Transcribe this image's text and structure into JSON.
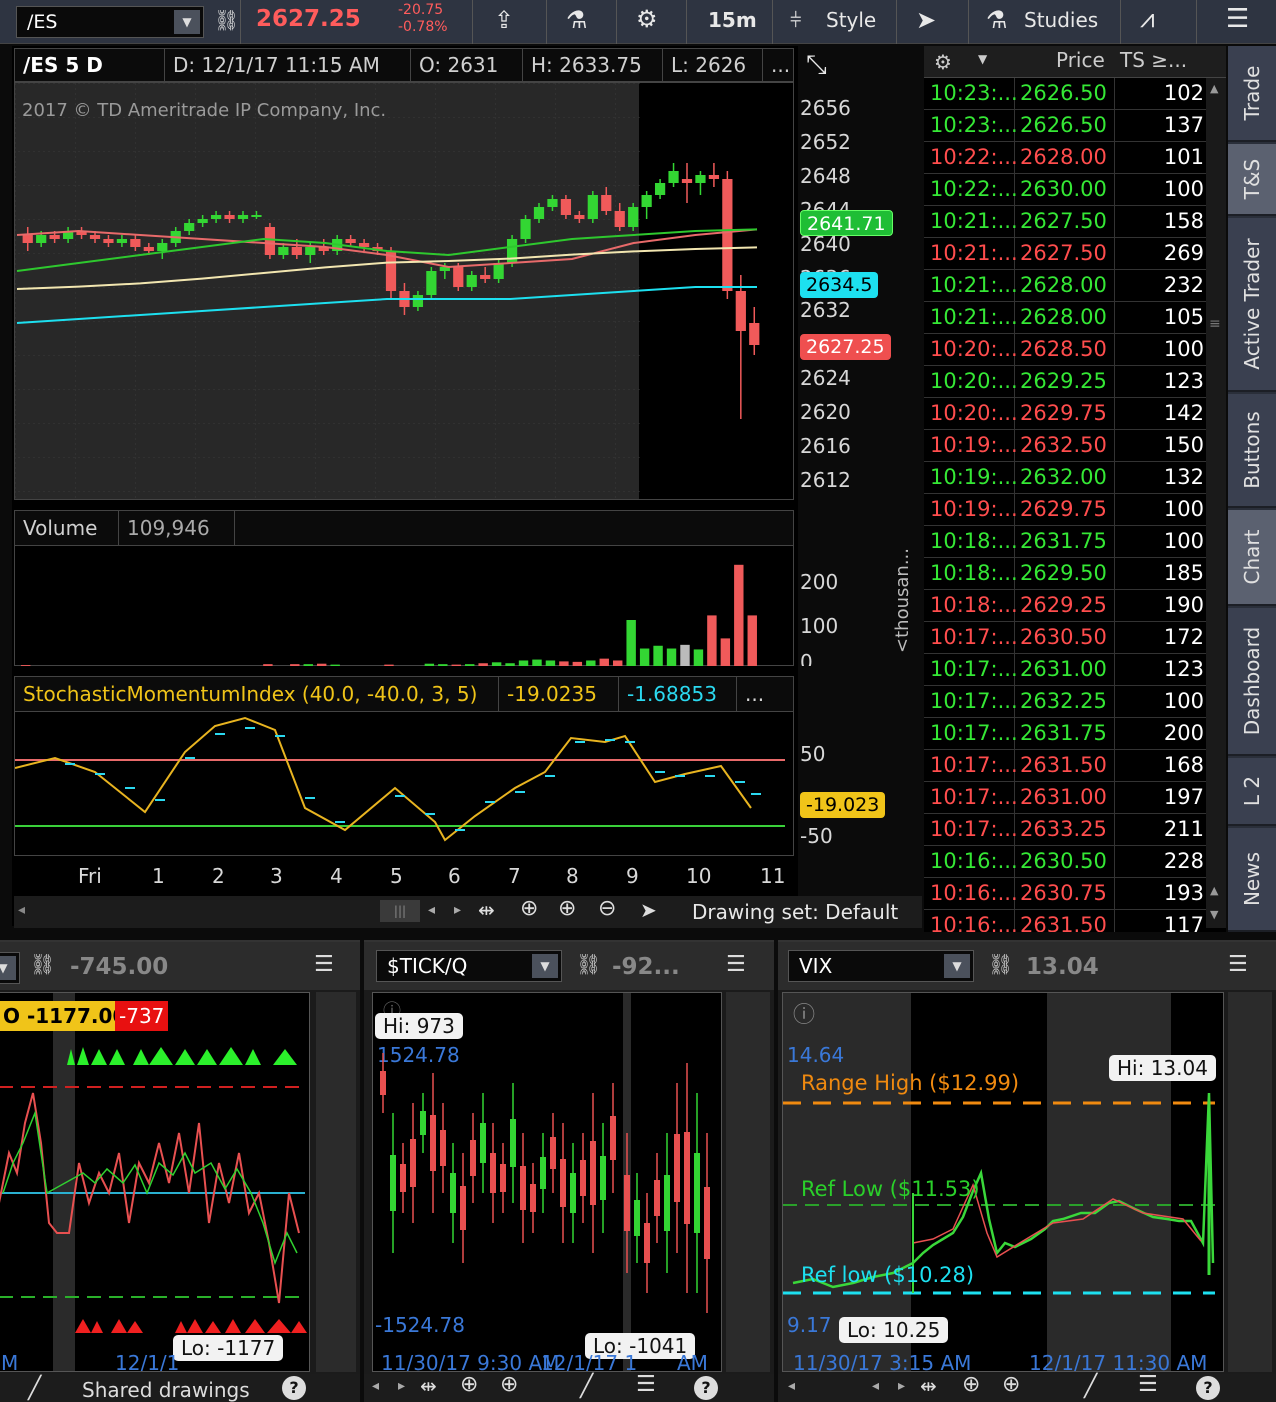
{
  "toolbar": {
    "symbol": "/ES",
    "last": "2627.25",
    "net_change": "-20.75",
    "net_change_pct": "-0.78%",
    "timeframe": "15m",
    "style_label": "Style",
    "studies_label": "Studies"
  },
  "chart": {
    "header": {
      "title": "/ES 5 D 15m",
      "date": "D: 12/1/17 11:15 AM",
      "open": "O: 2631",
      "high": "H: 2633.75",
      "low": "L: 2626",
      "more": "..."
    },
    "copyright": "2017 © TD Ameritrade IP Company, Inc.",
    "y_ticks": [
      "2656",
      "2652",
      "2648",
      "2644",
      "2640",
      "2636",
      "2632",
      "2624",
      "2620",
      "2616",
      "2612"
    ],
    "tags": {
      "green": "2641.71",
      "cyan": "2634.5",
      "red": "2627.25"
    },
    "volume": {
      "label": "Volume",
      "value": "109,946",
      "ticks": [
        "200",
        "100",
        "0"
      ],
      "unit": "<thousan..."
    },
    "smi": {
      "label": "StochasticMomentumIndex (40.0, -40.0, 3, 5)",
      "value1": "-19.0235",
      "value2": "-1.68853",
      "more": "...",
      "ticks": [
        "50",
        "-50"
      ],
      "tag": "-19.023"
    },
    "time_ticks": [
      "Fri",
      "1",
      "2",
      "3",
      "4",
      "5",
      "6",
      "7",
      "8",
      "9",
      "10",
      "11"
    ],
    "footer": {
      "drawing_set": "Drawing set: Default"
    }
  },
  "chart_data": {
    "type": "line",
    "title": "/ES 5 D 15m",
    "ylim": [
      2608,
      2660
    ],
    "series": [
      {
        "values": [
          2641,
          2641.5,
          2641,
          2640.5,
          2640,
          2639.5,
          2638.5,
          2637,
          2637.5,
          2638,
          2640,
          2641,
          2641.7
        ]
      },
      {
        "values": [
          2636.5,
          2637.5,
          2638.5,
          2639.5,
          2640.5,
          2640,
          2639,
          2638.5,
          2639.5,
          2640.5,
          2641,
          2641.5,
          2641.7
        ]
      },
      {
        "values": [
          2630,
          2630.5,
          2631,
          2631.5,
          2632,
          2632.5,
          2633,
          2633,
          2633,
          2633.5,
          2634,
          2634.5,
          2634.5
        ]
      }
    ]
  },
  "time_sales": {
    "header": {
      "price": "Price",
      "size": "TS ≥..."
    },
    "rows": [
      {
        "time": "10:23:...",
        "price": "2626.50",
        "size": "102",
        "color": "#35e835"
      },
      {
        "time": "10:23:...",
        "price": "2626.50",
        "size": "137",
        "color": "#35e835"
      },
      {
        "time": "10:22:...",
        "price": "2628.00",
        "size": "101",
        "color": "#ff4d4d"
      },
      {
        "time": "10:22:...",
        "price": "2630.00",
        "size": "100",
        "color": "#35e835"
      },
      {
        "time": "10:21:...",
        "price": "2627.50",
        "size": "158",
        "color": "#35e835"
      },
      {
        "time": "10:21:...",
        "price": "2627.50",
        "size": "269",
        "color": "#ff4d4d"
      },
      {
        "time": "10:21:...",
        "price": "2628.00",
        "size": "232",
        "color": "#35e835"
      },
      {
        "time": "10:21:...",
        "price": "2628.00",
        "size": "105",
        "color": "#35e835"
      },
      {
        "time": "10:20:...",
        "price": "2628.50",
        "size": "100",
        "color": "#ff4d4d"
      },
      {
        "time": "10:20:...",
        "price": "2629.25",
        "size": "123",
        "color": "#35e835"
      },
      {
        "time": "10:20:...",
        "price": "2629.75",
        "size": "142",
        "color": "#ff4d4d"
      },
      {
        "time": "10:19:...",
        "price": "2632.50",
        "size": "150",
        "color": "#ff4d4d"
      },
      {
        "time": "10:19:...",
        "price": "2632.00",
        "size": "132",
        "color": "#35e835"
      },
      {
        "time": "10:19:...",
        "price": "2629.75",
        "size": "100",
        "color": "#ff4d4d"
      },
      {
        "time": "10:18:...",
        "price": "2631.75",
        "size": "100",
        "color": "#35e835"
      },
      {
        "time": "10:18:...",
        "price": "2629.50",
        "size": "185",
        "color": "#35e835"
      },
      {
        "time": "10:18:...",
        "price": "2629.25",
        "size": "190",
        "color": "#ff4d4d"
      },
      {
        "time": "10:17:...",
        "price": "2630.50",
        "size": "172",
        "color": "#ff4d4d"
      },
      {
        "time": "10:17:...",
        "price": "2631.00",
        "size": "123",
        "color": "#35e835"
      },
      {
        "time": "10:17:...",
        "price": "2632.25",
        "size": "100",
        "color": "#35e835"
      },
      {
        "time": "10:17:...",
        "price": "2631.75",
        "size": "200",
        "color": "#35e835"
      },
      {
        "time": "10:17:...",
        "price": "2631.50",
        "size": "168",
        "color": "#ff4d4d"
      },
      {
        "time": "10:17:...",
        "price": "2631.00",
        "size": "197",
        "color": "#ff4d4d"
      },
      {
        "time": "10:17:...",
        "price": "2633.25",
        "size": "211",
        "color": "#ff4d4d"
      },
      {
        "time": "10:16:...",
        "price": "2630.50",
        "size": "228",
        "color": "#35e835"
      },
      {
        "time": "10:16:...",
        "price": "2630.75",
        "size": "193",
        "color": "#ff4d4d"
      },
      {
        "time": "10:16:...",
        "price": "2631.50",
        "size": "117",
        "color": "#ff4d4d"
      }
    ]
  },
  "tabs": [
    "Trade",
    "T&S",
    "Active Trader",
    "Buttons",
    "Chart",
    "Dashboard",
    "L 2",
    "News"
  ],
  "panel1": {
    "value": "-745.00",
    "badge1": "O -1177.00",
    "badge2": "-737",
    "lo": "Lo: -1177",
    "left_label": "M",
    "bottom_label": "12/1/1",
    "shared": "Shared drawings"
  },
  "panel2": {
    "symbol": "$TICK/Q",
    "value": "-92...",
    "hi": "Hi: 973",
    "top_val": "1524.78",
    "bot_val": "-1524.78",
    "lo": "Lo: -1041",
    "bottom_label": "11/30/17 9:30 AM",
    "bottom_label2": "12/1/17 1",
    "bottom_label3": "AM"
  },
  "panel3": {
    "symbol": "VIX",
    "value": "13.04",
    "top_val": "14.64",
    "range_high": "Range High ($12.99)",
    "ref_low1": "Ref Low ($11.53)",
    "ref_low2": "Ref low ($10.28)",
    "hi": "Hi: 13.04",
    "lo": "Lo: 10.25",
    "bot_val": "9.17",
    "time1": "11/30/17 3:15 AM",
    "time2": "12/1/17 11:30 AM"
  }
}
